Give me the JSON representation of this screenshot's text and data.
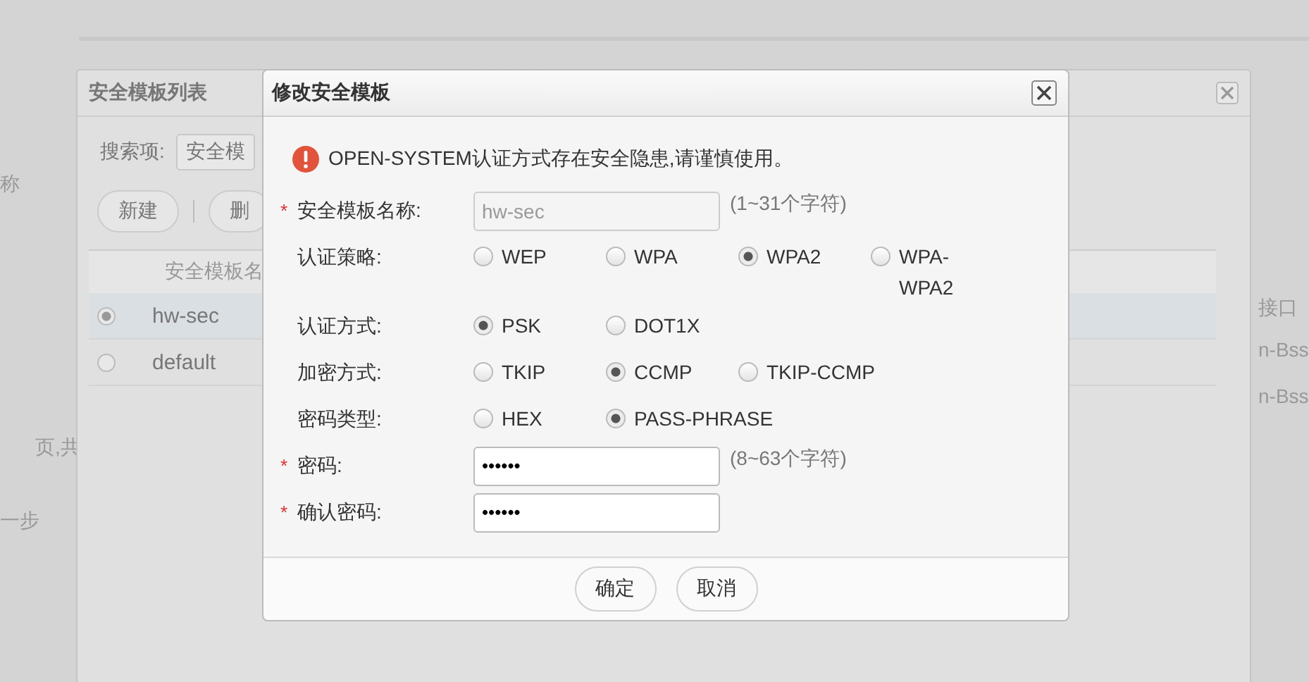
{
  "background_page": {
    "texts": [
      {
        "text": "称",
        "kind": "left_top"
      },
      {
        "text": "页,共",
        "kind": "left_pager"
      },
      {
        "text": "一步",
        "kind": "left_prev"
      },
      {
        "text": "接口",
        "kind": "right_header"
      },
      {
        "text": "n-Bss",
        "kind": "right_row1"
      },
      {
        "text": "n-Bss",
        "kind": "right_row2"
      }
    ]
  },
  "list_dialog": {
    "title": "安全模板列表",
    "search_label": "搜索项:",
    "search_value": "安全模",
    "buttons": [
      "新建",
      "删"
    ],
    "table": {
      "columns": [
        "安全模板名"
      ],
      "rows": [
        {
          "name": "hw-sec",
          "selected": true
        },
        {
          "name": "default",
          "selected": false
        }
      ]
    }
  },
  "edit_dialog": {
    "title": "修改安全模板",
    "warning": "OPEN-SYSTEM认证方式存在安全隐患,请谨慎使用。",
    "fields": [
      {
        "kind": "text",
        "label": "安全模板名称:",
        "required_mark": "*",
        "value": "hw-sec",
        "disabled": true,
        "hint": "(1~31个字符)"
      },
      {
        "kind": "radio",
        "label": "认证策略:",
        "options": [
          {
            "label": "WEP",
            "selected": false
          },
          {
            "label": "WPA",
            "selected": false
          },
          {
            "label": "WPA2",
            "selected": true
          },
          {
            "label": "WPA-WPA2",
            "selected": false
          }
        ]
      },
      {
        "kind": "radio",
        "label": "认证方式:",
        "options": [
          {
            "label": "PSK",
            "selected": true
          },
          {
            "label": "DOT1X",
            "selected": false
          }
        ]
      },
      {
        "kind": "radio",
        "label": "加密方式:",
        "options": [
          {
            "label": "TKIP",
            "selected": false
          },
          {
            "label": "CCMP",
            "selected": true
          },
          {
            "label": "TKIP-CCMP",
            "selected": false
          }
        ]
      },
      {
        "kind": "radio",
        "label": "密码类型:",
        "options": [
          {
            "label": "HEX",
            "selected": false
          },
          {
            "label": "PASS-PHRASE",
            "selected": true
          }
        ]
      },
      {
        "kind": "text",
        "label": "密码:",
        "required_mark": "*",
        "value": "••••••",
        "disabled": false,
        "hint": "(8~63个字符)"
      },
      {
        "kind": "text",
        "label": "确认密码:",
        "required_mark": "*",
        "value": "••••••",
        "disabled": false
      }
    ],
    "buttons": [
      "确定",
      "取消"
    ]
  }
}
